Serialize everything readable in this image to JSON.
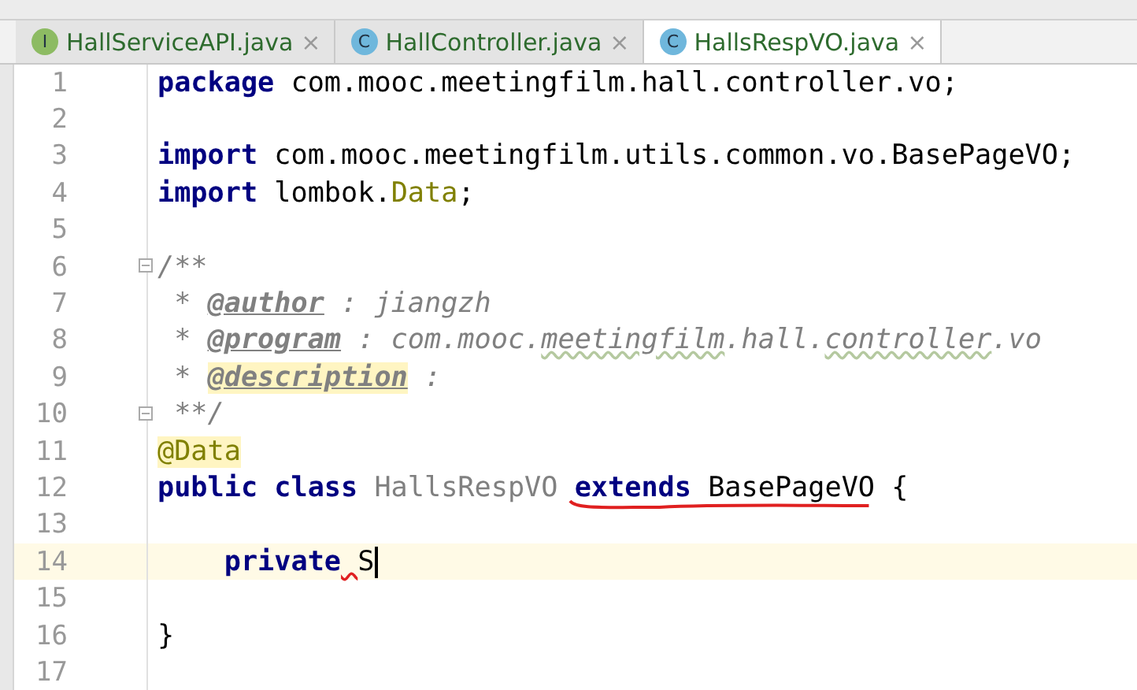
{
  "tabs": [
    {
      "icon_letter": "I",
      "kind": "interface",
      "label": "HallServiceAPI.java",
      "close": "×",
      "selected": false
    },
    {
      "icon_letter": "C",
      "kind": "class",
      "label": "HallController.java",
      "close": "×",
      "selected": false
    },
    {
      "icon_letter": "C",
      "kind": "class",
      "label": "HallsRespVO.java",
      "close": "×",
      "selected": true
    }
  ],
  "editor": {
    "lines": [
      {
        "number": "1",
        "tokens": [
          {
            "text": "package",
            "kind": "keyword"
          },
          {
            "text": " com.mooc.meetingfilm.hall.controller.vo;",
            "kind": "plain"
          }
        ]
      },
      {
        "number": "2"
      },
      {
        "number": "3",
        "tokens": [
          {
            "text": "import",
            "kind": "keyword"
          },
          {
            "text": " com.mooc.meetingfilm.utils.common.vo.BasePageVO;",
            "kind": "plain"
          }
        ]
      },
      {
        "number": "4",
        "tokens": [
          {
            "text": "import",
            "kind": "keyword"
          },
          {
            "text": " lombok.",
            "kind": "plain"
          },
          {
            "text": "Data",
            "kind": "annotation"
          },
          {
            "text": ";",
            "kind": "plain"
          }
        ]
      },
      {
        "number": "5"
      },
      {
        "number": "6",
        "fold_marker": true,
        "tokens": [
          {
            "text": "/**",
            "kind": "comment"
          }
        ]
      },
      {
        "number": "7",
        "tokens": [
          {
            "text": " * ",
            "kind": "comment"
          },
          {
            "text": "@author",
            "kind": "doctag"
          },
          {
            "text": " : jiangzh",
            "kind": "comment"
          }
        ]
      },
      {
        "number": "8",
        "tokens": [
          {
            "text": " * ",
            "kind": "comment"
          },
          {
            "text": "@program",
            "kind": "doctag"
          },
          {
            "text": " : com.mooc.",
            "kind": "comment"
          },
          {
            "text": "meetingfilm",
            "kind": "comment",
            "typo": true
          },
          {
            "text": ".hall.",
            "kind": "comment"
          },
          {
            "text": "controller",
            "kind": "comment",
            "typo": true
          },
          {
            "text": ".vo",
            "kind": "comment"
          }
        ]
      },
      {
        "number": "9",
        "tokens": [
          {
            "text": " * ",
            "kind": "comment"
          },
          {
            "text": "@description",
            "kind": "doctag_highlight"
          },
          {
            "text": " :",
            "kind": "comment"
          }
        ]
      },
      {
        "number": "10",
        "fold_marker": true,
        "tokens": [
          {
            "text": " **/",
            "kind": "comment"
          }
        ]
      },
      {
        "number": "11",
        "tokens": [
          {
            "text": "@Data",
            "kind": "annotation_highlight"
          }
        ]
      },
      {
        "number": "12",
        "tokens": [
          {
            "text": "public",
            "kind": "keyword"
          },
          {
            "text": " class",
            "kind": "keyword"
          },
          {
            "text": " HallsRespVO",
            "kind": "unused"
          },
          {
            "text": " extends",
            "kind": "keyword",
            "scribble": true
          },
          {
            "text": " BasePageVO",
            "kind": "plain",
            "scribble": true
          },
          {
            "text": " {",
            "kind": "plain"
          }
        ]
      },
      {
        "number": "13"
      },
      {
        "number": "14",
        "current": true,
        "tokens": [
          {
            "text": "    private",
            "kind": "keyword"
          },
          {
            "text": " S",
            "kind": "plain",
            "error": true
          }
        ]
      },
      {
        "number": "15"
      },
      {
        "number": "16",
        "tokens": [
          {
            "text": "}",
            "kind": "plain"
          }
        ]
      },
      {
        "number": "17"
      }
    ]
  }
}
